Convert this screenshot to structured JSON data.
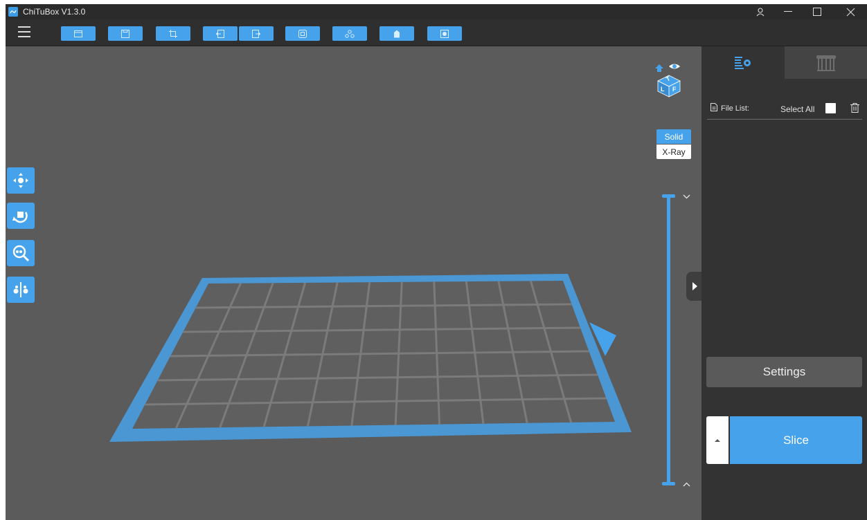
{
  "window": {
    "title": "ChiTuBox V1.3.0"
  },
  "toolbar": {
    "buttons": [
      {
        "icon": "open-file-icon"
      },
      {
        "icon": "save-icon"
      },
      {
        "icon": "screenshot-icon"
      },
      {
        "icon": "undo-icon"
      },
      {
        "icon": "redo-icon"
      },
      {
        "icon": "copy-icon"
      },
      {
        "icon": "arrange-icon"
      },
      {
        "icon": "hollow-icon"
      },
      {
        "icon": "dig-hole-icon"
      }
    ]
  },
  "viewport": {
    "left_tools": [
      "move-icon",
      "rotate-icon",
      "scale-icon",
      "mirror-icon"
    ],
    "view_cube": {
      "faces": [
        "T",
        "L",
        "F"
      ]
    },
    "render_modes": {
      "solid": "Solid",
      "xray": "X-Ray",
      "active": "Solid"
    },
    "grid_color": "#46a2ea"
  },
  "panel": {
    "tabs": [
      "settings-tab-icon",
      "support-tab-icon"
    ],
    "file_list_label": "File List:",
    "select_all_label": "Select All",
    "settings_button": "Settings",
    "slice_button": "Slice"
  },
  "colors": {
    "accent": "#46a2ea",
    "bg": "#5b5b5b",
    "panel": "#333333",
    "toolbar": "#2f2f2f"
  }
}
